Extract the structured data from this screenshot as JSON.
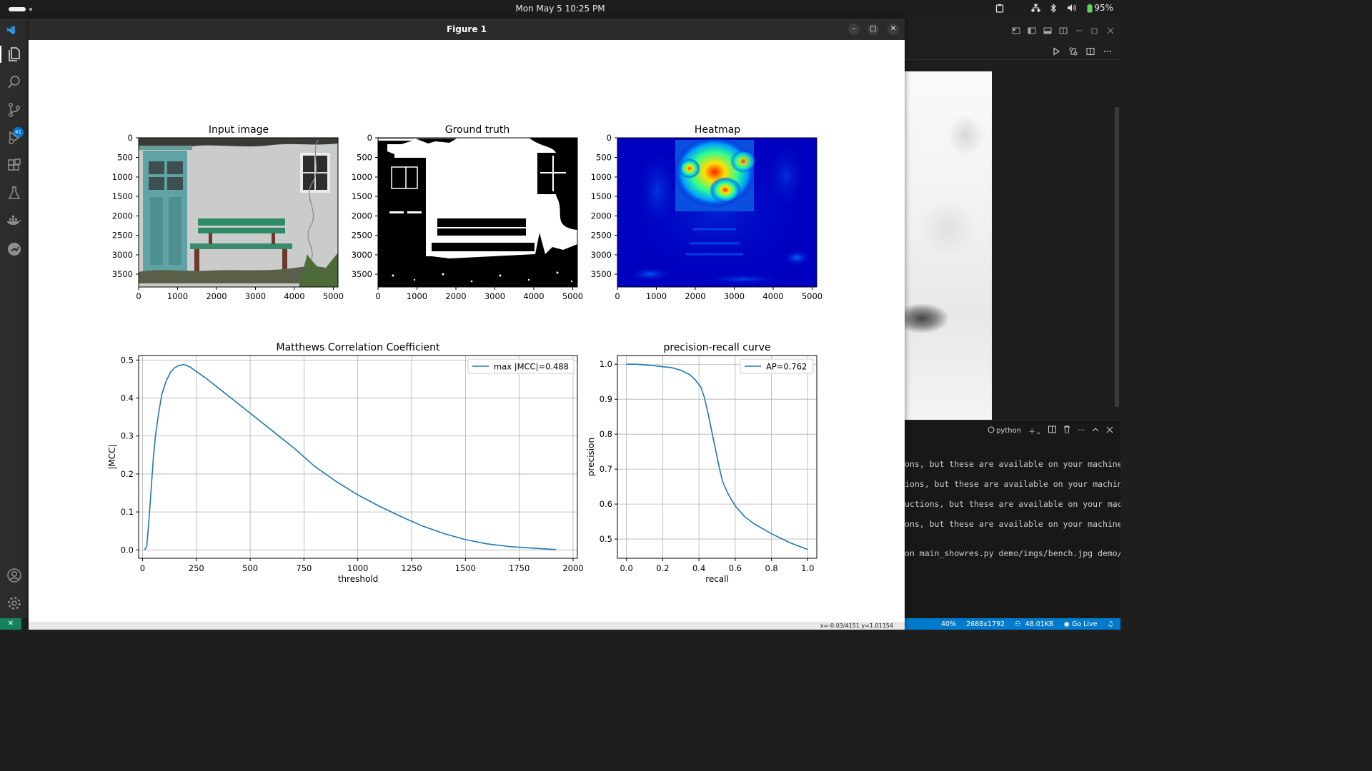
{
  "topbar": {
    "clock": "Mon May 5  10:25 PM",
    "battery": "95%"
  },
  "activity_bar": {
    "items": [
      "explorer-icon",
      "search-icon",
      "source-control-icon",
      "run-debug-icon",
      "extensions-icon",
      "testing-icon",
      "docker-icon",
      "remote-explorer-icon",
      "account-icon",
      "settings-gear-icon"
    ],
    "source_control_badge": "41"
  },
  "figure_window": {
    "title": "Figure 1",
    "coords": "x=-0.03/4151  y=1.01154"
  },
  "panels": {
    "input_title": "Input image",
    "gt_title": "Ground truth",
    "heat_title": "Heatmap",
    "image_xticks": [
      "0",
      "1000",
      "2000",
      "3000",
      "4000",
      "5000"
    ],
    "image_yticks": [
      "0",
      "500",
      "1000",
      "1500",
      "2000",
      "2500",
      "3000",
      "3500"
    ]
  },
  "chart_data": [
    {
      "type": "line",
      "title": "Matthews Correlation Coefficient",
      "xlabel": "threshold",
      "ylabel": "|MCC|",
      "xlim": [
        -18,
        2020
      ],
      "ylim": [
        -0.022,
        0.512
      ],
      "xticks": [
        "0",
        "250",
        "500",
        "750",
        "1000",
        "1250",
        "1500",
        "1750",
        "2000"
      ],
      "yticks": [
        "0.0",
        "0.1",
        "0.2",
        "0.3",
        "0.4",
        "0.5"
      ],
      "grid": true,
      "legend_position": "top-right",
      "series": [
        {
          "name": "max |MCC|=0.488",
          "color": "#1f77b4",
          "x": [
            10,
            20,
            30,
            40,
            50,
            60,
            75,
            90,
            110,
            130,
            150,
            170,
            190,
            200,
            220,
            250,
            300,
            400,
            500,
            600,
            700,
            800,
            900,
            1000,
            1100,
            1200,
            1300,
            1400,
            1500,
            1600,
            1700,
            1800,
            1920
          ],
          "y": [
            0.0,
            0.01,
            0.08,
            0.16,
            0.24,
            0.3,
            0.36,
            0.41,
            0.445,
            0.468,
            0.48,
            0.486,
            0.488,
            0.487,
            0.482,
            0.47,
            0.45,
            0.405,
            0.36,
            0.315,
            0.27,
            0.22,
            0.18,
            0.145,
            0.115,
            0.088,
            0.063,
            0.043,
            0.027,
            0.016,
            0.009,
            0.005,
            0.001
          ]
        }
      ]
    },
    {
      "type": "line",
      "title": "precision-recall curve",
      "xlabel": "recall",
      "ylabel": "precision",
      "xlim": [
        -0.05,
        1.05
      ],
      "ylim": [
        0.445,
        1.025
      ],
      "xticks": [
        "0.0",
        "0.2",
        "0.4",
        "0.6",
        "0.8",
        "1.0"
      ],
      "yticks": [
        "0.5",
        "0.6",
        "0.7",
        "0.8",
        "0.9",
        "1.0"
      ],
      "grid": true,
      "legend_position": "top-right",
      "series": [
        {
          "name": "AP=0.762",
          "color": "#1f77b4",
          "x": [
            0.0,
            0.05,
            0.1,
            0.15,
            0.2,
            0.25,
            0.3,
            0.35,
            0.38,
            0.41,
            0.43,
            0.45,
            0.47,
            0.49,
            0.51,
            0.53,
            0.56,
            0.6,
            0.65,
            0.7,
            0.8,
            0.9,
            1.0
          ],
          "y": [
            1.0,
            1.0,
            0.998,
            0.996,
            0.993,
            0.99,
            0.983,
            0.97,
            0.955,
            0.935,
            0.905,
            0.86,
            0.81,
            0.76,
            0.71,
            0.665,
            0.63,
            0.595,
            0.565,
            0.545,
            0.515,
            0.49,
            0.47
          ]
        }
      ]
    }
  ],
  "terminal": {
    "shell_label": "python",
    "lines": [
      "ons, but these are available on your machine",
      "ions, but these are available on your machin",
      "uctions, but these are available on your mac",
      "ons, but these are available on your machine",
      "on main_showres.py demo/imgs/bench.jpg demo/"
    ]
  },
  "status_bar": {
    "items": [
      "40%",
      "2688x1792",
      "48.01KB",
      "Go Live"
    ]
  }
}
